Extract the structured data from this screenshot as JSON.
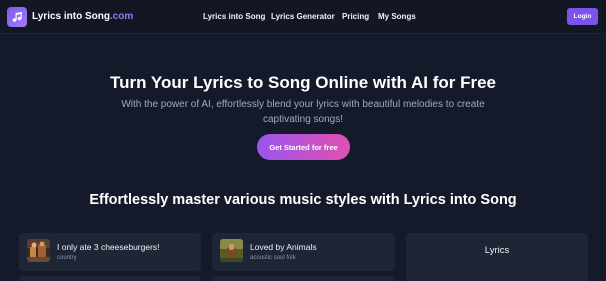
{
  "brand": {
    "name": "Lyrics into Song",
    "suffix": ".com",
    "accent": "#7a54e8"
  },
  "nav": {
    "links": [
      "Lyrics into Song",
      "Lyrics Generator",
      "Pricing",
      "My Songs"
    ],
    "login_label": "Login"
  },
  "hero": {
    "title": "Turn Your Lyrics to Song Online with AI for Free",
    "subtitle": "With the power of AI, effortlessly blend your lyrics with beautiful melodies to create captivating songs!",
    "cta_label": "Get Started for free",
    "cta_gradient": [
      "#9a55ef",
      "#e24fb0"
    ]
  },
  "styles_section": {
    "title": "Effortlessly master various music styles with Lyrics into Song",
    "cards": [
      {
        "title": "I only ate 3 cheeseburgers!",
        "genre": "country"
      },
      {
        "title": "Loved by Animals",
        "genre": "acoustic soul folk"
      }
    ],
    "lyrics_panel_label": "Lyrics"
  }
}
